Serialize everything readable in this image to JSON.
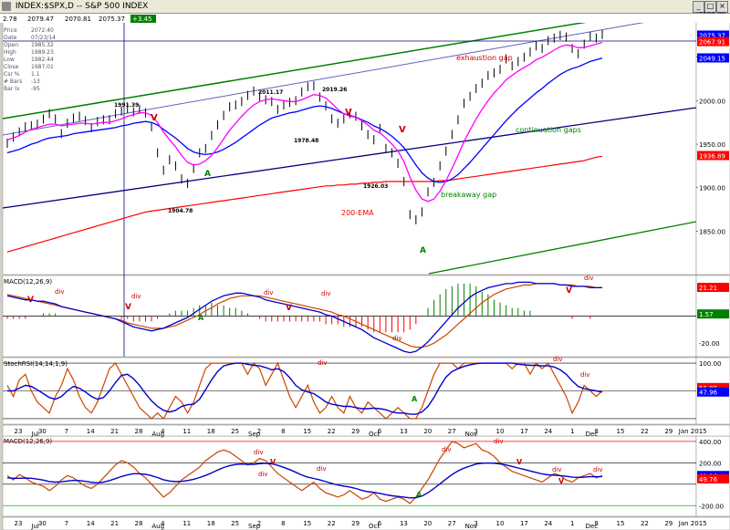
{
  "window": {
    "title": "INDEX:$SPX,D -- S&P 500 INDEX",
    "menu_icon": "window-menu-icon",
    "buttons": [
      "minimize-icon",
      "maximize-icon",
      "close-icon"
    ]
  },
  "header_values": {
    "last": "2079.47",
    "mid": "2070.81",
    "close_val": "2075.37",
    "change": "+3.45",
    "left_cut": "2.78"
  },
  "data_window": [
    {
      "label": "Price",
      "value": "2072.40"
    },
    {
      "label": "Date",
      "value": "07/23/14"
    },
    {
      "label": "Open",
      "value": "1985.32"
    },
    {
      "label": "High",
      "value": "1989.23"
    },
    {
      "label": "Low",
      "value": "1982.44"
    },
    {
      "label": "Close",
      "value": "1987.01"
    },
    {
      "label": "Csr %",
      "value": "1.1"
    },
    {
      "label": "# Bars",
      "value": "-13"
    },
    {
      "label": "Bar Ix",
      "value": "-95"
    }
  ],
  "colors": {
    "bg": "#ffffff",
    "price_bar": "#000000",
    "ma_fast": "#ff00ff",
    "ma_slow": "#0000ff",
    "ema200": "#ff0000",
    "channel_green": "#008000",
    "channel_navy": "#000080",
    "macd_line": "#0000cc",
    "signal_line": "#cc4400",
    "hist_pos": "#008000",
    "hist_neg": "#ff0000",
    "rsi": "#cc4400",
    "rsi_signal": "#0000cc",
    "tag_bg_blue": "#0000ff",
    "tag_bg_red": "#ff0000",
    "tag_bg_green": "#008000"
  },
  "chart_data": [
    {
      "type": "line",
      "panel": "price",
      "ylim": [
        1800,
        2100
      ],
      "y_ticks": [
        "2100.00",
        "2050.00",
        "2000.00",
        "1950.00",
        "1900.00",
        "1850.00"
      ],
      "right_tags": [
        {
          "text": "2075.37",
          "value": 2075.37,
          "color": "tag_bg_blue"
        },
        {
          "text": "2067.91",
          "value": 2067.91,
          "color": "tag_bg_red"
        },
        {
          "text": "2049.15",
          "value": 2049.15,
          "color": "tag_bg_blue"
        },
        {
          "text": "1936.89",
          "value": 1936.89,
          "color": "tag_bg_red"
        }
      ],
      "price_series": [
        1951,
        1958,
        1964,
        1970,
        1971,
        1973,
        1979,
        1985,
        1979,
        1962,
        1974,
        1980,
        1982,
        1977,
        1969,
        1976,
        1978,
        1978,
        1985,
        1988,
        1991,
        1987,
        1990,
        1986,
        1970,
        1940,
        1920,
        1932,
        1925,
        1910,
        1905,
        1922,
        1940,
        1945,
        1960,
        1972,
        1983,
        1993,
        1995,
        1999,
        2006,
        2011,
        2005,
        2001,
        1999,
        1990,
        1995,
        1998,
        2000,
        2010,
        2016,
        2017,
        2004,
        1994,
        1979,
        1974,
        1979,
        1985,
        1982,
        1971,
        1961,
        1955,
        1968,
        1945,
        1940,
        1928,
        1907,
        1869,
        1863,
        1872,
        1895,
        1906,
        1925,
        1942,
        1961,
        1978,
        1997,
        2005,
        2014,
        2020,
        2029,
        2032,
        2036,
        2048,
        2040,
        2045,
        2050,
        2056,
        2063,
        2060,
        2069,
        2072,
        2075,
        2073,
        2060,
        2054,
        2065,
        2074,
        2072,
        2076
      ],
      "ma_fast_series": [
        1955,
        1957,
        1960,
        1964,
        1967,
        1969,
        1971,
        1973,
        1973,
        1971,
        1972,
        1973,
        1974,
        1974,
        1973,
        1974,
        1975,
        1975,
        1977,
        1979,
        1982,
        1984,
        1986,
        1986,
        1983,
        1975,
        1964,
        1955,
        1947,
        1937,
        1929,
        1926,
        1927,
        1931,
        1937,
        1946,
        1956,
        1966,
        1974,
        1982,
        1989,
        1995,
        1999,
        2001,
        2002,
        2001,
        2000,
        1999,
        1999,
        2001,
        2004,
        2007,
        2006,
        2003,
        1997,
        1990,
        1985,
        1982,
        1981,
        1977,
        1972,
        1966,
        1963,
        1957,
        1950,
        1942,
        1930,
        1912,
        1897,
        1887,
        1884,
        1887,
        1896,
        1908,
        1922,
        1937,
        1953,
        1966,
        1979,
        1990,
        2000,
        2009,
        2016,
        2024,
        2029,
        2034,
        2038,
        2042,
        2047,
        2050,
        2054,
        2058,
        2062,
        2064,
        2063,
        2061,
        2061,
        2063,
        2065,
        2067
      ],
      "ma_slow_series": [
        1940,
        1942,
        1944,
        1947,
        1950,
        1952,
        1955,
        1957,
        1958,
        1959,
        1960,
        1962,
        1963,
        1964,
        1965,
        1966,
        1967,
        1968,
        1969,
        1971,
        1972,
        1974,
        1975,
        1976,
        1975,
        1972,
        1967,
        1962,
        1957,
        1951,
        1945,
        1941,
        1939,
        1938,
        1939,
        1941,
        1944,
        1948,
        1952,
        1957,
        1962,
        1967,
        1972,
        1976,
        1980,
        1982,
        1984,
        1986,
        1987,
        1989,
        1991,
        1993,
        1994,
        1993,
        1991,
        1988,
        1985,
        1983,
        1981,
        1978,
        1975,
        1971,
        1968,
        1964,
        1959,
        1953,
        1946,
        1936,
        1926,
        1917,
        1911,
        1907,
        1906,
        1907,
        1910,
        1915,
        1922,
        1929,
        1937,
        1945,
        1953,
        1961,
        1969,
        1977,
        1984,
        1991,
        1997,
        2003,
        2009,
        2014,
        2020,
        2025,
        2030,
        2034,
        2037,
        2039,
        2042,
        2045,
        2047,
        2049
      ],
      "ema200_series": [
        1826,
        1828,
        1830,
        1832,
        1834,
        1836,
        1838,
        1840,
        1842,
        1844,
        1846,
        1848,
        1850,
        1852,
        1854,
        1856,
        1858,
        1860,
        1862,
        1864,
        1866,
        1868,
        1870,
        1872,
        1873,
        1874,
        1875,
        1876,
        1877,
        1878,
        1879,
        1880,
        1881,
        1882,
        1883,
        1884,
        1885,
        1886,
        1887,
        1888,
        1889,
        1890,
        1891,
        1892,
        1893,
        1894,
        1895,
        1896,
        1897,
        1898,
        1899,
        1900,
        1901,
        1902,
        1902,
        1903,
        1903,
        1904,
        1904,
        1905,
        1905,
        1906,
        1906,
        1907,
        1907,
        1907,
        1907,
        1907,
        1907,
        1907,
        1907,
        1907,
        1908,
        1908,
        1909,
        1910,
        1911,
        1912,
        1913,
        1914,
        1915,
        1916,
        1917,
        1918,
        1919,
        1920,
        1921,
        1922,
        1923,
        1924,
        1925,
        1926,
        1927,
        1928,
        1929,
        1930,
        1931,
        1933,
        1935,
        1936
      ],
      "labels": [
        {
          "text": "1991.39",
          "kind": "price"
        },
        {
          "text": "2011.17",
          "kind": "price"
        },
        {
          "text": "2019.26",
          "kind": "price"
        },
        {
          "text": "1978.48",
          "kind": "price"
        },
        {
          "text": "1926.03",
          "kind": "price"
        },
        {
          "text": "1904.78",
          "kind": "price"
        },
        {
          "text": "200-EMA",
          "kind": "note"
        },
        {
          "text": "exhaustion gap",
          "kind": "note"
        },
        {
          "text": "continuation gaps",
          "kind": "note"
        },
        {
          "text": "breakaway gap",
          "kind": "note"
        },
        {
          "text": "V",
          "kind": "marker"
        },
        {
          "text": "A",
          "kind": "marker"
        }
      ]
    },
    {
      "type": "line",
      "panel": "macd1",
      "title": "MACD(12,26,9)",
      "ylim": [
        -30,
        30
      ],
      "y_ticks": [
        "-20.00"
      ],
      "right_tags": [
        {
          "text": "21.21",
          "value": 21.21,
          "color": "tag_bg_red"
        },
        {
          "text": "1.57",
          "value": 1.57,
          "color": "tag_bg_green"
        }
      ],
      "macd_series": [
        15,
        14,
        13,
        12,
        12,
        11,
        11,
        10,
        9,
        7,
        6,
        5,
        4,
        3,
        2,
        1,
        0,
        -1,
        -2,
        -4,
        -6,
        -8,
        -9,
        -10,
        -11,
        -10,
        -9,
        -7,
        -5,
        -3,
        -1,
        2,
        5,
        8,
        11,
        13,
        15,
        16,
        17,
        17,
        16,
        15,
        14,
        12,
        11,
        10,
        9,
        8,
        7,
        6,
        5,
        4,
        3,
        1,
        0,
        -2,
        -4,
        -6,
        -8,
        -10,
        -13,
        -16,
        -18,
        -20,
        -22,
        -24,
        -26,
        -27,
        -26,
        -23,
        -19,
        -14,
        -9,
        -4,
        1,
        6,
        10,
        14,
        17,
        19,
        21,
        22,
        23,
        24,
        24,
        25,
        25,
        25,
        24,
        24,
        24,
        24,
        23,
        23,
        22,
        22,
        22,
        21,
        21,
        21
      ],
      "signal_series": [
        16,
        15,
        14,
        13,
        12,
        11,
        10,
        9,
        8,
        7,
        6,
        5,
        4,
        3,
        2,
        1,
        0,
        -1,
        -2,
        -3,
        -5,
        -6,
        -7,
        -8,
        -9,
        -9,
        -9,
        -8,
        -7,
        -5,
        -3,
        -1,
        1,
        4,
        6,
        9,
        11,
        13,
        14,
        15,
        15,
        15,
        15,
        14,
        13,
        12,
        11,
        10,
        9,
        8,
        7,
        6,
        5,
        4,
        3,
        1,
        0,
        -2,
        -4,
        -6,
        -8,
        -10,
        -12,
        -14,
        -16,
        -18,
        -20,
        -22,
        -23,
        -23,
        -22,
        -20,
        -17,
        -14,
        -10,
        -6,
        -2,
        2,
        6,
        10,
        13,
        16,
        18,
        20,
        21,
        22,
        23,
        23,
        24,
        24,
        24,
        24,
        23,
        23,
        23,
        22,
        22,
        22,
        21,
        21
      ],
      "labels": [
        {
          "text": "div",
          "kind": "note"
        },
        {
          "text": "V",
          "kind": "marker"
        },
        {
          "text": "A",
          "kind": "marker"
        }
      ]
    },
    {
      "type": "line",
      "panel": "stochrsi",
      "title": "StochRSI(14,14,1,9)",
      "ylim": [
        -10,
        110
      ],
      "y_ticks": [
        "100.00",
        "50.00"
      ],
      "right_tags": [
        {
          "text": "56.02",
          "value": 56.02,
          "color": "tag_bg_red"
        },
        {
          "text": "47.96",
          "value": 47.96,
          "color": "tag_bg_blue"
        }
      ],
      "rsi_series": [
        60,
        40,
        70,
        80,
        50,
        30,
        20,
        10,
        40,
        60,
        90,
        70,
        40,
        20,
        10,
        30,
        60,
        90,
        100,
        80,
        60,
        40,
        20,
        10,
        0,
        10,
        0,
        20,
        40,
        30,
        10,
        30,
        60,
        90,
        100,
        100,
        100,
        100,
        100,
        100,
        80,
        100,
        90,
        60,
        80,
        100,
        70,
        40,
        20,
        40,
        60,
        30,
        10,
        20,
        40,
        20,
        10,
        40,
        20,
        10,
        30,
        20,
        10,
        0,
        10,
        20,
        10,
        0,
        0,
        20,
        50,
        80,
        100,
        100,
        100,
        90,
        100,
        100,
        100,
        100,
        100,
        100,
        100,
        100,
        90,
        100,
        100,
        80,
        100,
        90,
        100,
        80,
        60,
        40,
        10,
        30,
        60,
        50,
        40,
        50
      ],
      "signal_series": [
        50,
        50,
        55,
        60,
        58,
        52,
        45,
        38,
        35,
        40,
        50,
        58,
        55,
        48,
        40,
        35,
        38,
        50,
        65,
        78,
        80,
        72,
        60,
        45,
        32,
        22,
        15,
        12,
        15,
        22,
        25,
        26,
        35,
        52,
        70,
        85,
        95,
        98,
        100,
        100,
        98,
        96,
        95,
        92,
        88,
        90,
        85,
        74,
        60,
        52,
        48,
        45,
        38,
        30,
        26,
        24,
        22,
        22,
        20,
        18,
        18,
        19,
        18,
        16,
        12,
        10,
        10,
        8,
        8,
        12,
        22,
        38,
        58,
        75,
        85,
        90,
        94,
        97,
        99,
        100,
        100,
        100,
        100,
        100,
        100,
        98,
        97,
        96,
        96,
        95,
        95,
        93,
        88,
        80,
        68,
        58,
        54,
        52,
        50,
        48
      ],
      "labels": [
        {
          "text": "div",
          "kind": "note"
        },
        {
          "text": "A",
          "kind": "marker"
        }
      ]
    },
    {
      "type": "line",
      "panel": "macd2",
      "title": "MACD(12,26,9)",
      "ylim": [
        -300,
        450
      ],
      "y_ticks": [
        "400.00",
        "200.00",
        "-200.00"
      ],
      "right_tags": [
        {
          "text": "81.16",
          "value": 81.16,
          "color": "tag_bg_blue"
        },
        {
          "text": "49.76",
          "value": 49.76,
          "color": "tag_bg_red"
        }
      ],
      "macd_series": [
        80,
        40,
        90,
        60,
        20,
        0,
        -20,
        -60,
        -20,
        40,
        80,
        60,
        20,
        -20,
        -40,
        0,
        60,
        120,
        180,
        220,
        200,
        160,
        100,
        60,
        0,
        -60,
        -120,
        -80,
        -20,
        40,
        80,
        120,
        160,
        220,
        260,
        300,
        320,
        300,
        260,
        220,
        180,
        200,
        240,
        220,
        160,
        100,
        60,
        20,
        -20,
        -60,
        -20,
        20,
        -40,
        -80,
        -100,
        -120,
        -100,
        -60,
        -100,
        -140,
        -120,
        -80,
        -140,
        -160,
        -140,
        -120,
        -140,
        -180,
        -120,
        -40,
        40,
        140,
        240,
        320,
        400,
        380,
        340,
        360,
        380,
        320,
        300,
        260,
        200,
        160,
        120,
        100,
        80,
        60,
        40,
        20,
        60,
        100,
        80,
        40,
        20,
        60,
        80,
        100,
        60,
        80
      ],
      "signal_series": [
        60,
        55,
        55,
        58,
        55,
        48,
        38,
        25,
        20,
        22,
        30,
        36,
        34,
        26,
        18,
        14,
        20,
        34,
        52,
        72,
        88,
        98,
        98,
        92,
        80,
        62,
        42,
        30,
        24,
        26,
        34,
        46,
        62,
        82,
        106,
        132,
        156,
        174,
        184,
        188,
        186,
        186,
        192,
        196,
        190,
        176,
        158,
        136,
        112,
        86,
        66,
        54,
        40,
        24,
        8,
        -8,
        -18,
        -26,
        -40,
        -58,
        -70,
        -76,
        -86,
        -98,
        -108,
        -114,
        -120,
        -128,
        -126,
        -110,
        -80,
        -40,
        4,
        48,
        90,
        124,
        150,
        170,
        188,
        196,
        198,
        196,
        190,
        180,
        166,
        152,
        138,
        124,
        110,
        96,
        88,
        84,
        80,
        74,
        66,
        64,
        66,
        70,
        70,
        72
      ],
      "labels": [
        {
          "text": "div",
          "kind": "note"
        },
        {
          "text": "V",
          "kind": "marker"
        },
        {
          "text": "A",
          "kind": "marker"
        }
      ]
    }
  ],
  "x_axis": {
    "day_ticks": [
      "23",
      "30",
      "7",
      "14",
      "21",
      "28",
      "4",
      "11",
      "18",
      "25",
      "2",
      "8",
      "15",
      "22",
      "29",
      "6",
      "13",
      "20",
      "27",
      "3",
      "10",
      "17",
      "24",
      "1",
      "8",
      "15",
      "22",
      "29",
      "Jan 2015"
    ],
    "months": [
      "Jul",
      "Aug",
      "Sep",
      "Oct",
      "Nov",
      "Dec"
    ]
  }
}
